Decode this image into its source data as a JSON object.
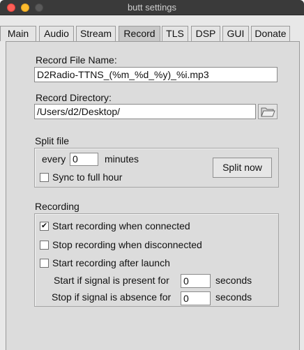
{
  "window": {
    "title": "butt settings"
  },
  "tabs": [
    {
      "label": "Main"
    },
    {
      "label": "Audio"
    },
    {
      "label": "Stream"
    },
    {
      "label": "Record",
      "active": true
    },
    {
      "label": "TLS"
    },
    {
      "label": "DSP"
    },
    {
      "label": "GUI"
    },
    {
      "label": "Donate"
    }
  ],
  "record": {
    "file_name_label": "Record File Name:",
    "file_name_value": "D2Radio-TTNS_(%m_%d_%y)_%i.mp3",
    "directory_label": "Record Directory:",
    "directory_value": "/Users/d2/Desktop/",
    "browse_icon": "folder-icon"
  },
  "split": {
    "group_label": "Split file",
    "every_label": "every",
    "every_value": "0",
    "minutes_label": "minutes",
    "sync_label": "Sync to full hour",
    "sync_checked": false,
    "split_now_label": "Split now"
  },
  "recording": {
    "group_label": "Recording",
    "start_connected_label": "Start recording when connected",
    "start_connected_checked": true,
    "stop_disconnected_label": "Stop recording when disconnected",
    "stop_disconnected_checked": false,
    "start_after_launch_label": "Start recording after launch",
    "start_after_launch_checked": false,
    "signal_present_label": "Start if signal is present for",
    "signal_present_value": "0",
    "signal_absence_label": "Stop if signal is absence for",
    "signal_absence_value": "0",
    "seconds_label": "seconds"
  },
  "colors": {
    "close": "#fe5f57",
    "minimize": "#febc2e",
    "titlebar": "#3a3a3a",
    "panel": "#dcdcdc"
  }
}
